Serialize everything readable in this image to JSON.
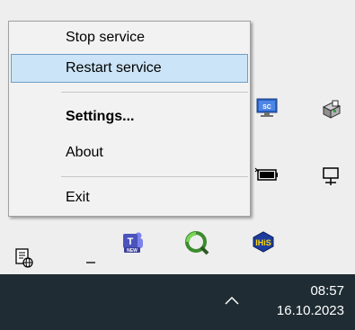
{
  "context_menu": {
    "items": [
      {
        "label": "Stop service"
      },
      {
        "label": "Restart service"
      },
      {
        "label": "Settings..."
      },
      {
        "label": "About"
      },
      {
        "label": "Exit"
      }
    ]
  },
  "tray": {
    "icons": [
      "sc-monitor-icon",
      "printer-icon",
      "battery-icon",
      "network-monitor-icon",
      "network-settings-icon",
      "minus-icon",
      "teams-new-icon",
      "green-r-icon",
      "ihis-icon"
    ],
    "sc_label": "SC",
    "ihis_label": "IHiS",
    "teams_label": "NEW"
  },
  "taskbar": {
    "time": "08:57",
    "date": "16.10.2023"
  }
}
